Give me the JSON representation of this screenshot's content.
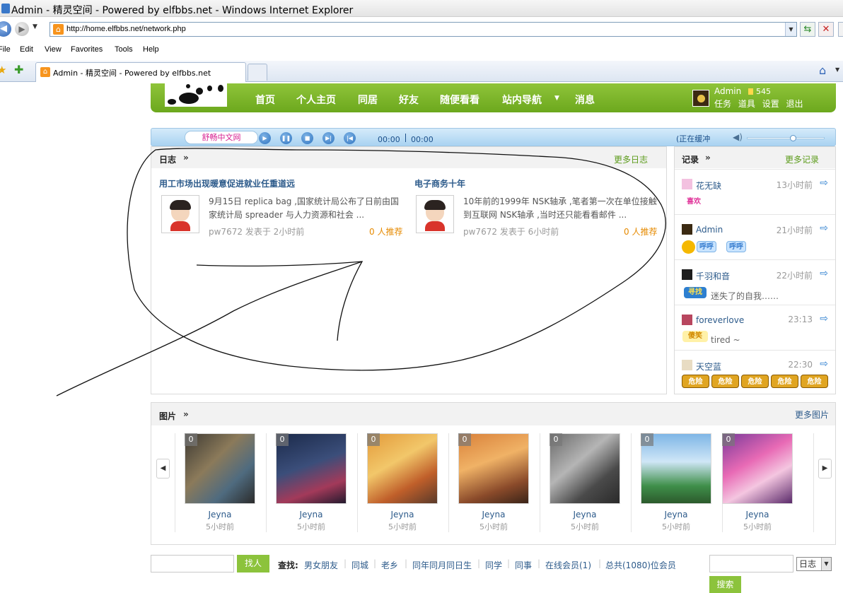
{
  "window": {
    "title": "Admin - 精灵空间 - Powered by elfbbs.net - Windows Internet Explorer"
  },
  "browser": {
    "url": "http://home.elfbbs.net/network.php",
    "menu": [
      "File",
      "Edit",
      "View",
      "Favorites",
      "Tools",
      "Help"
    ],
    "tab_title": "Admin - 精灵空间 - Powered by elfbbs.net"
  },
  "site_nav": {
    "items": [
      "首页",
      "个人主页",
      "同居",
      "好友",
      "随便看看",
      "站内导航",
      "消息"
    ],
    "user": {
      "name": "Admin",
      "credits": "545",
      "links": [
        "任务",
        "道具",
        "设置",
        "退出"
      ]
    }
  },
  "player": {
    "title": "舒畅中文网",
    "time_current": "00:00",
    "time_total": "00:00",
    "status": "(正在缓冲",
    "volume": 0.6
  },
  "blog": {
    "title": "日志",
    "more": "更多日志",
    "posts": [
      {
        "title": "用工市场出现暖意促进就业任重道远",
        "excerpt": "9月15日 replica bag ,国家统计局公布了日前由国家统计局 spreader 与人力资源和社会 ...",
        "author": "pw7672",
        "posted_label": "发表于",
        "time": "2小时前",
        "recommend": "0 人推荐"
      },
      {
        "title": "电子商务十年",
        "excerpt": "10年前的1999年 NSK轴承 ,笔者第一次在单位接触到互联网 NSK轴承 ,当时还只能看看邮件 ...",
        "author": "pw7672",
        "posted_label": "发表于",
        "time": "6小时前",
        "recommend": "0 人推荐"
      }
    ]
  },
  "records": {
    "title": "记录",
    "more": "更多记录",
    "items": [
      {
        "user": "花无缺",
        "time": "13小时前",
        "text": "",
        "emoticons": [
          "喜欢"
        ]
      },
      {
        "user": "Admin",
        "time": "21小时前",
        "text": "",
        "emoticons": [
          "",
          "呼呼",
          "呼呼"
        ]
      },
      {
        "user": "千羽和音",
        "time": "22小时前",
        "text": "迷失了的自我……",
        "emoticons": [
          "寻找"
        ]
      },
      {
        "user": "foreverlove",
        "time": "23:13",
        "text": "tired ~",
        "emoticons": [
          "傻笑"
        ]
      },
      {
        "user": "天空蓝",
        "time": "22:30",
        "text": "",
        "emoticons": [
          "危险",
          "危险",
          "危险",
          "危险",
          "危险"
        ]
      }
    ]
  },
  "photos": {
    "title": "图片",
    "more": "更多图片",
    "items": [
      {
        "count": "0",
        "author": "Jeyna",
        "time": "5小时前"
      },
      {
        "count": "0",
        "author": "Jeyna",
        "time": "5小时前"
      },
      {
        "count": "0",
        "author": "Jeyna",
        "time": "5小时前"
      },
      {
        "count": "0",
        "author": "Jeyna",
        "time": "5小时前"
      },
      {
        "count": "0",
        "author": "Jeyna",
        "time": "5小时前"
      },
      {
        "count": "0",
        "author": "Jeyna",
        "time": "5小时前"
      },
      {
        "count": "0",
        "author": "Jeyna",
        "time": "5小时前"
      }
    ]
  },
  "search_bar": {
    "find_button": "找人",
    "search_label": "查找:",
    "links": [
      "男女朋友",
      "同城",
      "老乡",
      "同年同月同日生",
      "同学",
      "同事",
      "在线会员(1)",
      "总共(1080)位会员"
    ],
    "scope": "日志",
    "search_button": "搜索"
  },
  "colors": {
    "brand_green": "#7cb82a",
    "link_blue": "#2d5b8b",
    "recommend_orange": "#e68a00"
  }
}
